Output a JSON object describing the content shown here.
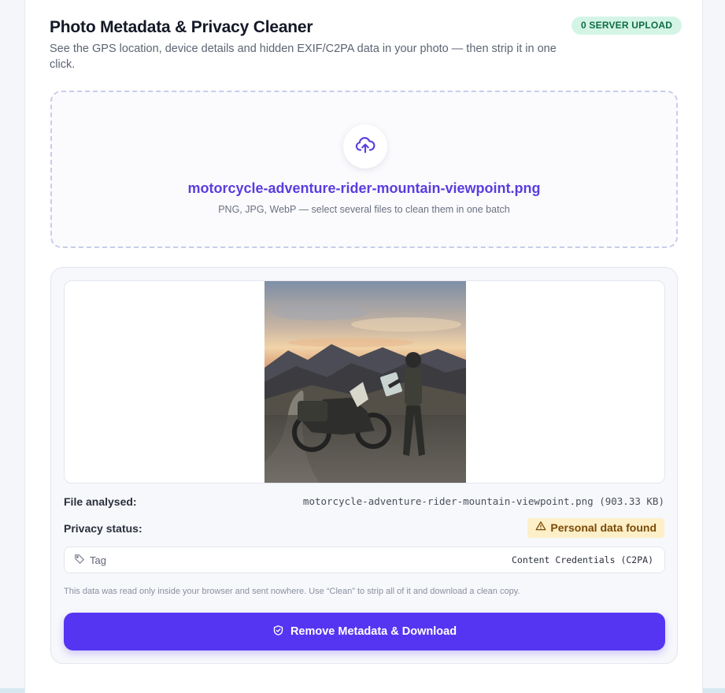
{
  "header": {
    "title": "Photo Metadata & Privacy Cleaner",
    "subtitle": "See the GPS location, device details and hidden EXIF/C2PA data in your photo — then strip it in one click.",
    "badge": "0 SERVER UPLOAD"
  },
  "dropzone": {
    "filename": "motorcycle-adventure-rider-mountain-viewpoint.png",
    "hint": "PNG, JPG, WebP — select several files to clean them in one batch",
    "icon": "cloud-upload-icon"
  },
  "result": {
    "file_label": "File analysed:",
    "file_value": "motorcycle-adventure-rider-mountain-viewpoint.png (903.33 KB)",
    "status_label": "Privacy status:",
    "status_value": "Personal data found",
    "tag_label": "Tag",
    "tag_value": "Content Credentials (C2PA)",
    "note": "This data was read only inside your browser and sent nowhere. Use “Clean” to strip all of it and download a clean copy.",
    "button_label": "Remove Metadata & Download"
  },
  "colors": {
    "accent": "#5535f2",
    "filename": "#5a3ddd",
    "badge_bg": "#d4f5e6",
    "badge_text": "#0f6b45",
    "warning_bg": "#fdefc8",
    "warning_text": "#7a4a06"
  }
}
